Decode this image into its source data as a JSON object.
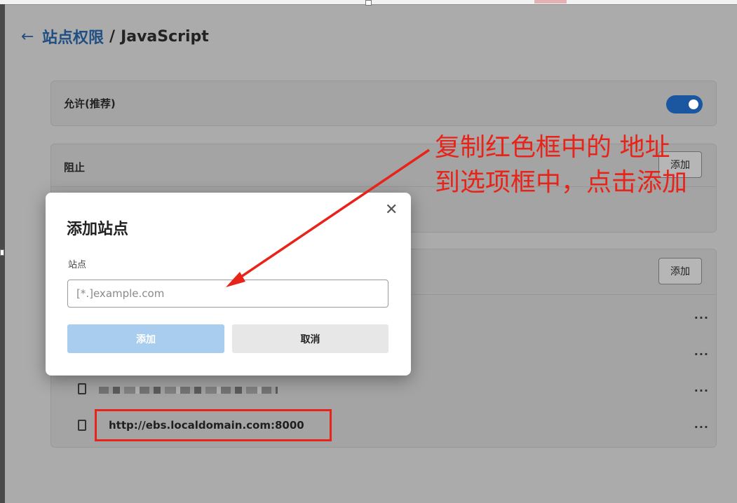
{
  "header": {
    "back_icon": "back-arrow-icon",
    "breadcrumb_link": "站点权限",
    "separator": "/",
    "title": "JavaScript"
  },
  "allow": {
    "label": "允许(推荐)",
    "toggle_on": true,
    "toggle_color": "#1b56a0"
  },
  "block": {
    "label": "阻止",
    "add_label": "添加"
  },
  "exceptions": {
    "add_label": "添加",
    "rows": [
      {
        "text": "",
        "more": "..."
      },
      {
        "text": "",
        "more": "..."
      },
      {
        "text": "",
        "more": "..."
      },
      {
        "text": "http://ebs.localdomain.com:8000",
        "more": "..."
      }
    ]
  },
  "dialog": {
    "title": "添加站点",
    "close_icon": "close-icon",
    "field_label": "站点",
    "input_placeholder": "[*.]example.com",
    "input_value": "",
    "add_label": "添加",
    "cancel_label": "取消"
  },
  "annotation": {
    "line1": "复制红色框中的 地址",
    "line2": "到选项框中，点击添加",
    "color": "#e8231a"
  }
}
